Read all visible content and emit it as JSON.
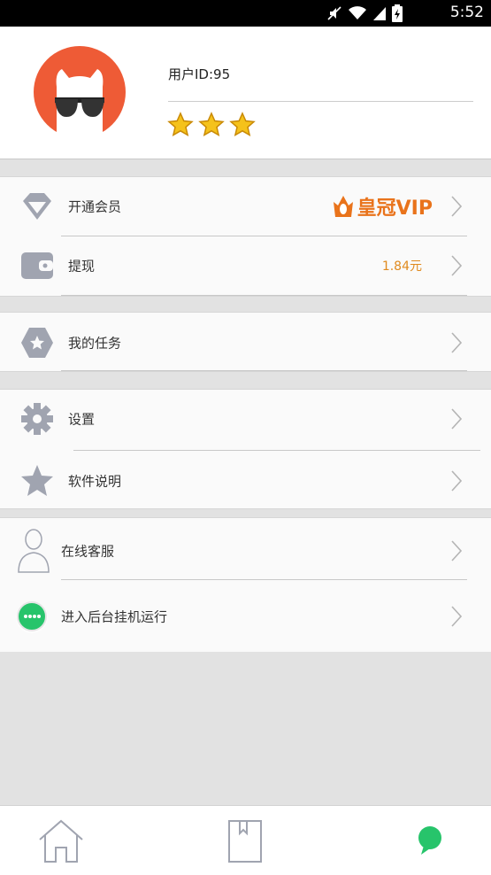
{
  "status_bar": {
    "time": "5:52",
    "icons": [
      "mute-icon",
      "wifi-icon",
      "signal-icon",
      "battery-icon"
    ]
  },
  "profile": {
    "user_id": "用户ID:95",
    "star_count": 3
  },
  "menu": {
    "vip": {
      "label": "开通会员",
      "badge": "皇冠VIP"
    },
    "withdraw": {
      "label": "提现",
      "value": "1.84元"
    },
    "tasks": {
      "label": "我的任务"
    },
    "settings": {
      "label": "设置"
    },
    "manual": {
      "label": "软件说明"
    },
    "support": {
      "label": "在线客服"
    },
    "background": {
      "label": "进入后台挂机运行"
    }
  },
  "bottom_tabs": [
    "home-icon",
    "bookmark-icon",
    "chat-bubble-icon"
  ],
  "colors": {
    "accent_orange": "#e9731b",
    "value_orange": "#e08a1e",
    "active_green": "#27c46b",
    "icon_gray": "#a0a4b0"
  }
}
